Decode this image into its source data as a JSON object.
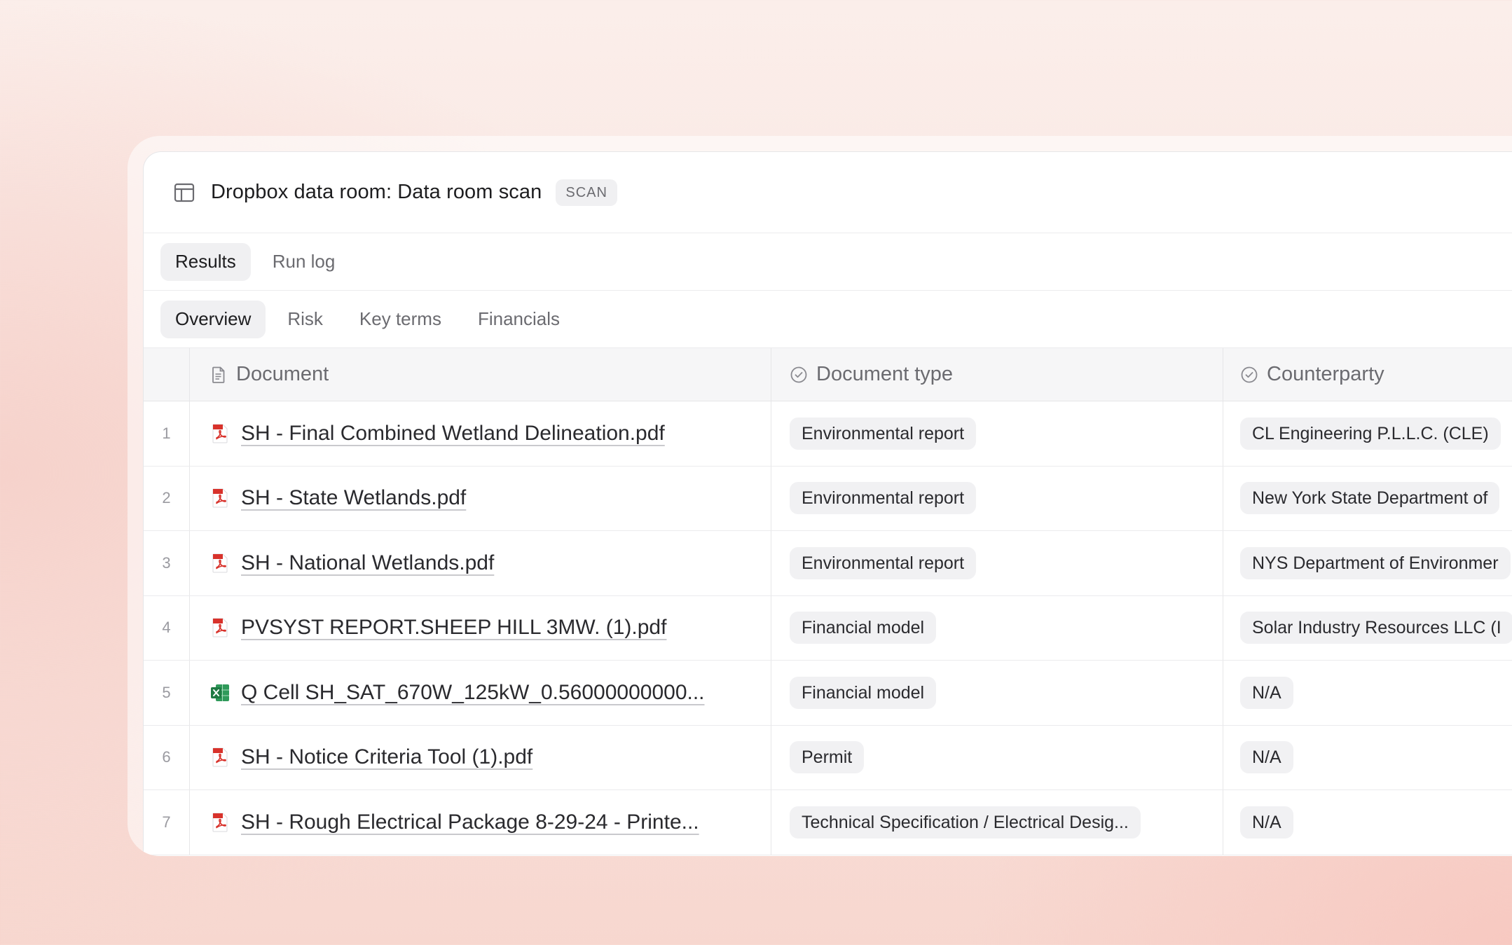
{
  "window": {
    "title": "Dropbox data room: Data room scan",
    "badge": "SCAN"
  },
  "tabs_primary": [
    {
      "label": "Results",
      "active": true
    },
    {
      "label": "Run log",
      "active": false
    }
  ],
  "tabs_secondary": [
    {
      "label": "Overview",
      "active": true
    },
    {
      "label": "Risk",
      "active": false
    },
    {
      "label": "Key terms",
      "active": false
    },
    {
      "label": "Financials",
      "active": false
    }
  ],
  "table": {
    "columns": {
      "document": "Document",
      "document_type": "Document type",
      "counterparty": "Counterparty"
    },
    "rows": [
      {
        "index": "1",
        "file_icon": "pdf-icon",
        "document": "SH - Final Combined Wetland Delineation.pdf",
        "document_type": "Environmental report",
        "counterparty": "CL Engineering P.L.L.C. (CLE)"
      },
      {
        "index": "2",
        "file_icon": "pdf-icon",
        "document": "SH - State Wetlands.pdf",
        "document_type": "Environmental report",
        "counterparty": "New York State Department of"
      },
      {
        "index": "3",
        "file_icon": "pdf-icon",
        "document": "SH - National Wetlands.pdf",
        "document_type": "Environmental report",
        "counterparty": "NYS Department of Environmer"
      },
      {
        "index": "4",
        "file_icon": "pdf-icon",
        "document": "PVSYST REPORT.SHEEP HILL 3MW. (1).pdf",
        "document_type": "Financial model",
        "counterparty": "Solar Industry Resources LLC (I"
      },
      {
        "index": "5",
        "file_icon": "excel-icon",
        "document": "Q Cell SH_SAT_670W_125kW_0.56000000000...",
        "document_type": "Financial model",
        "counterparty": "N/A"
      },
      {
        "index": "6",
        "file_icon": "pdf-icon",
        "document": "SH - Notice Criteria Tool (1).pdf",
        "document_type": "Permit",
        "counterparty": "N/A"
      },
      {
        "index": "7",
        "file_icon": "pdf-icon",
        "document": "SH - Rough Electrical Package 8-29-24 - Printe...",
        "document_type": "Technical Specification / Electrical Desig...",
        "counterparty": "N/A"
      }
    ]
  },
  "colors": {
    "pdf_icon": "#d8322b",
    "excel_icon": "#1f7a43",
    "pill_bg": "#f1f1f3",
    "active_tab_bg": "#f0f0f2"
  }
}
